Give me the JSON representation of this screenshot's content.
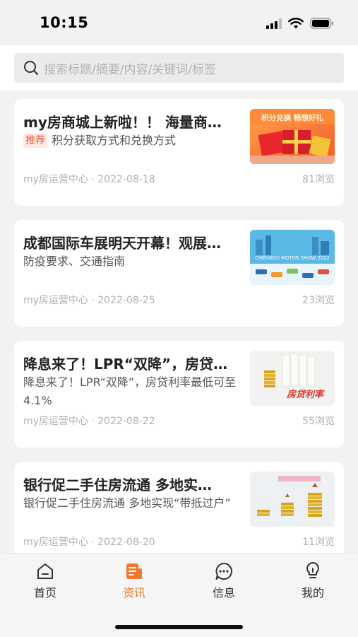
{
  "status_bar": {
    "time": "10:15"
  },
  "search": {
    "placeholder": "搜索标题/摘要/内容/关键词/标签"
  },
  "articles": [
    {
      "title": "my房商城上新啦！！ 海量商…",
      "tag": "推荐",
      "summary": "积分获取方式和兑换方式",
      "source_date": "my房运营中心 · 2022-08-18",
      "views": "81浏览",
      "thumb_text": "积分兑换  畅想好礼"
    },
    {
      "title": "成都国际车展明天开幕！观展…",
      "summary": "防疫要求、交通指南",
      "source_date": "my房运营中心 · 2022-08-25",
      "views": "23浏览",
      "thumb_text": "CHENGDU MOTOR SHOW 2022"
    },
    {
      "title": "降息来了！LPR“双降”，房贷…",
      "summary": "降息来了！LPR“双降”，房贷利率最低可至4.1%",
      "source_date": "my房运营中心 · 2022-08-22",
      "views": "55浏览",
      "thumb_text": "房贷利率"
    },
    {
      "title": "银行促二手住房流通 多地实…",
      "summary": "银行促二手住房流通 多地实现“带抵过户”",
      "source_date": "my房运营中心 · 2022-08-20",
      "views": "11浏览"
    }
  ],
  "tabbar": {
    "items": [
      {
        "label": "首页",
        "icon": "home-icon"
      },
      {
        "label": "资讯",
        "icon": "news-icon",
        "active": true
      },
      {
        "label": "信息",
        "icon": "message-icon"
      },
      {
        "label": "我的",
        "icon": "profile-icon"
      }
    ]
  },
  "colors": {
    "accent": "#f07a2b",
    "tag_text": "#ee5a3a",
    "tag_bg": "#fde8e2"
  }
}
